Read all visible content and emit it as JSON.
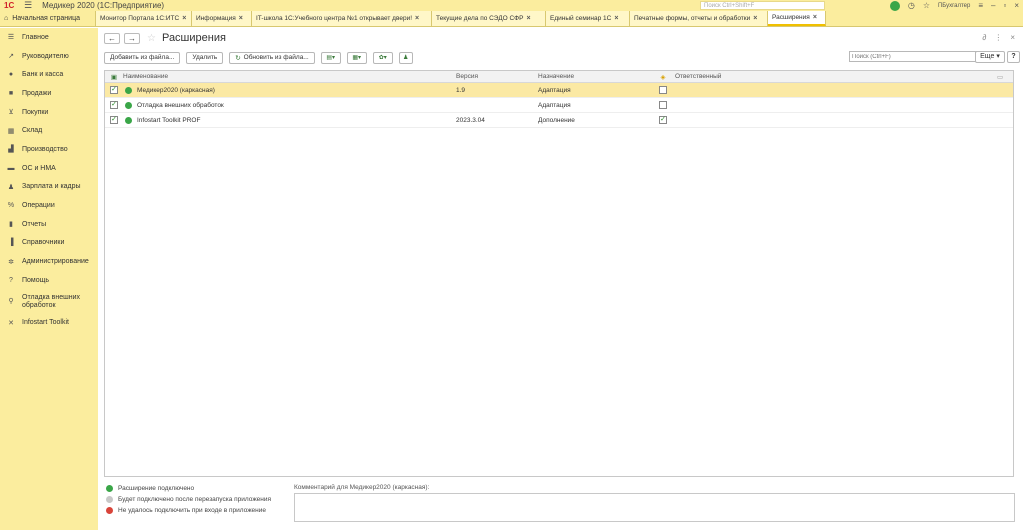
{
  "titlebar": {
    "app_title": "Медикер 2020  (1С:Предприятие)",
    "search_placeholder": "Поиск Ctrl+Shift+F",
    "user": "ПБухгалтер"
  },
  "tabs": {
    "home": "Начальная страница",
    "items": [
      {
        "label": "Монитор Портала 1С:ИТС"
      },
      {
        "label": "Информация"
      },
      {
        "label": "IT-школа 1С:Учебного центра №1 открывает двери!"
      },
      {
        "label": "Текущие дела по СЭДО СФР"
      },
      {
        "label": "Единый семинар 1С"
      },
      {
        "label": "Печатные формы, отчеты и обработки"
      },
      {
        "label": "Расширения"
      }
    ]
  },
  "sidebar": {
    "items": [
      {
        "label": "Главное",
        "icon": "menu-icon"
      },
      {
        "label": "Руководителю",
        "icon": "trend-icon"
      },
      {
        "label": "Банк и касса",
        "icon": "bank-icon"
      },
      {
        "label": "Продажи",
        "icon": "bag-icon"
      },
      {
        "label": "Покупки",
        "icon": "cart-icon"
      },
      {
        "label": "Склад",
        "icon": "warehouse-icon"
      },
      {
        "label": "Производство",
        "icon": "factory-icon"
      },
      {
        "label": "ОС и НМА",
        "icon": "truck-icon"
      },
      {
        "label": "Зарплата и кадры",
        "icon": "person-icon"
      },
      {
        "label": "Операции",
        "icon": "percent-icon"
      },
      {
        "label": "Отчеты",
        "icon": "chart-icon"
      },
      {
        "label": "Справочники",
        "icon": "book-icon"
      },
      {
        "label": "Администрирование",
        "icon": "gear-icon"
      },
      {
        "label": "Помощь",
        "icon": "question-icon"
      },
      {
        "label": "Отладка внешних обработок",
        "icon": "debug-icon"
      },
      {
        "label": "Infostart Toolkit",
        "icon": "tools-icon"
      }
    ]
  },
  "page": {
    "title": "Расширения",
    "back": "←",
    "forward": "→"
  },
  "toolbar": {
    "add_from_file": "Добавить из файла...",
    "delete": "Удалить",
    "update_from_file": "Обновить из файла...",
    "search_placeholder": "Поиск (Ctrl+F)",
    "more": "Еще",
    "help": "?"
  },
  "table": {
    "headers": {
      "name": "Наименование",
      "version": "Версия",
      "purpose": "Назначение",
      "owner": "Ответственный"
    },
    "rows": [
      {
        "name": "Медикер2020 (каркасная)",
        "version": "1.9",
        "purpose": "Адаптация",
        "responsible": false
      },
      {
        "name": "Отладка внешних обработок",
        "version": "",
        "purpose": "Адаптация",
        "responsible": false
      },
      {
        "name": "Infostart Toolkit PROF",
        "version": "2023.3.04",
        "purpose": "Дополнение",
        "responsible": true
      }
    ]
  },
  "legend": {
    "connected": "Расширение подключено",
    "after_restart": "Будет подключено после перезапуска приложения",
    "failed": "Не удалось подключить при входе в приложение"
  },
  "comment": {
    "label": "Комментарий для Медикер2020 (каркасная):",
    "value": ""
  },
  "colors": {
    "accent": "#fbed9e",
    "selected_row": "#fbe9a4",
    "ok": "#3aa648",
    "pending": "#c8c8c8",
    "error": "#d9443a"
  }
}
